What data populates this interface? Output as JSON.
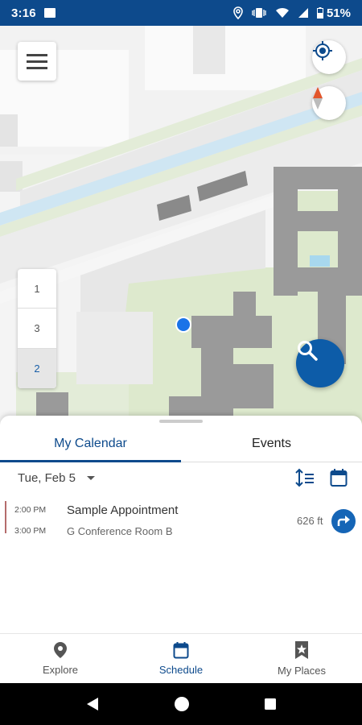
{
  "status_bar": {
    "time": "3:16",
    "battery": "51%"
  },
  "map": {
    "floors": [
      "1",
      "3",
      "2"
    ],
    "active_floor": "2"
  },
  "calendar": {
    "tabs": [
      {
        "label": "My Calendar",
        "active": true
      },
      {
        "label": "Events",
        "active": false
      }
    ],
    "date": "Tue, Feb 5",
    "appointments": [
      {
        "start": "2:00 PM",
        "end": "3:00 PM",
        "title": "Sample Appointment",
        "location": "G Conference Room B",
        "distance": "626 ft"
      }
    ]
  },
  "bottom_nav": {
    "items": [
      {
        "label": "Explore",
        "icon": "pin-icon",
        "active": false
      },
      {
        "label": "Schedule",
        "icon": "calendar-icon",
        "active": true
      },
      {
        "label": "My Places",
        "icon": "bookmark-star-icon",
        "active": false
      }
    ]
  },
  "colors": {
    "primary": "#0d4a8c",
    "accent": "#1565b6",
    "appointment_bar": "#b56c6c"
  }
}
